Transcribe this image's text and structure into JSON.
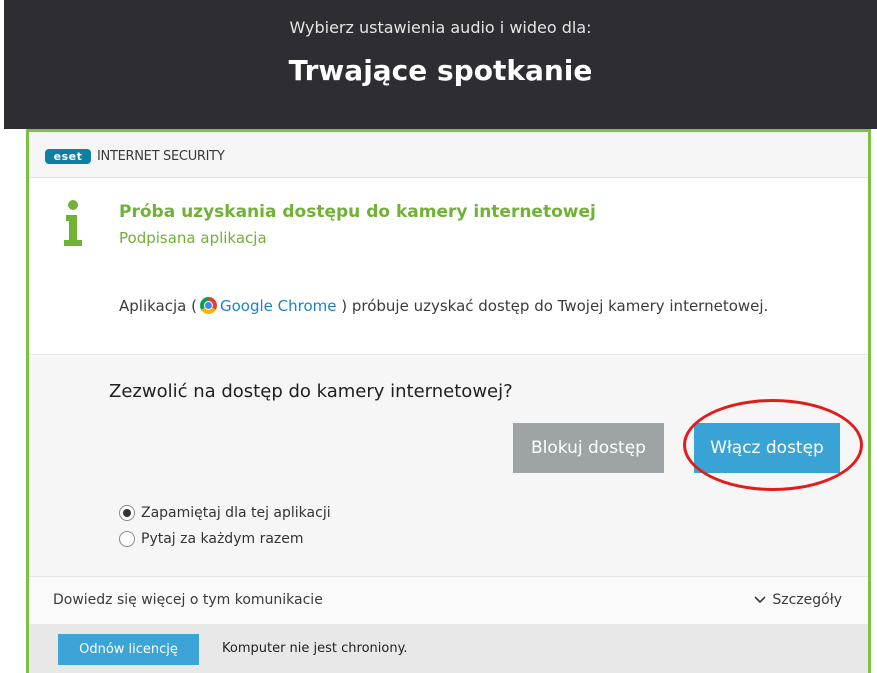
{
  "banner": {
    "subtitle": "Wybierz ustawienia audio i wideo dla:",
    "title": "Trwające spotkanie"
  },
  "dialog": {
    "brand_logo": "eset",
    "product_name": "INTERNET SECURITY",
    "icon": "info-icon",
    "alert_title": "Próba uzyskania dostępu do kamery internetowej",
    "alert_subtitle": "Podpisana aplikacja",
    "app_line": {
      "prefix": "Aplikacja (",
      "app_name": "Google Chrome",
      "suffix": " ) próbuje uzyskać dostęp do Twojej kamery internetowej."
    },
    "question": "Zezwolić na dostęp do kamery internetowej?",
    "buttons": {
      "block": "Blokuj dostęp",
      "allow": "Włącz dostęp"
    },
    "radio_options": [
      {
        "label": "Zapamiętaj dla tej aplikacji",
        "checked": true
      },
      {
        "label": "Pytaj za każdym razem",
        "checked": false
      }
    ],
    "footer": {
      "learn_more": "Dowiedz się więcej o tym komunikacie",
      "details": "Szczegóły"
    },
    "license": {
      "renew_button": "Odnów licencję",
      "status": "Komputer nie jest chroniony."
    }
  },
  "colors": {
    "banner_bg": "#2e2d33",
    "eset_green": "#7bc142",
    "link_blue": "#1a83c7",
    "allow_button": "#39a3d6",
    "block_button": "#9ea3a6",
    "highlight_ring": "#e31b1b"
  }
}
